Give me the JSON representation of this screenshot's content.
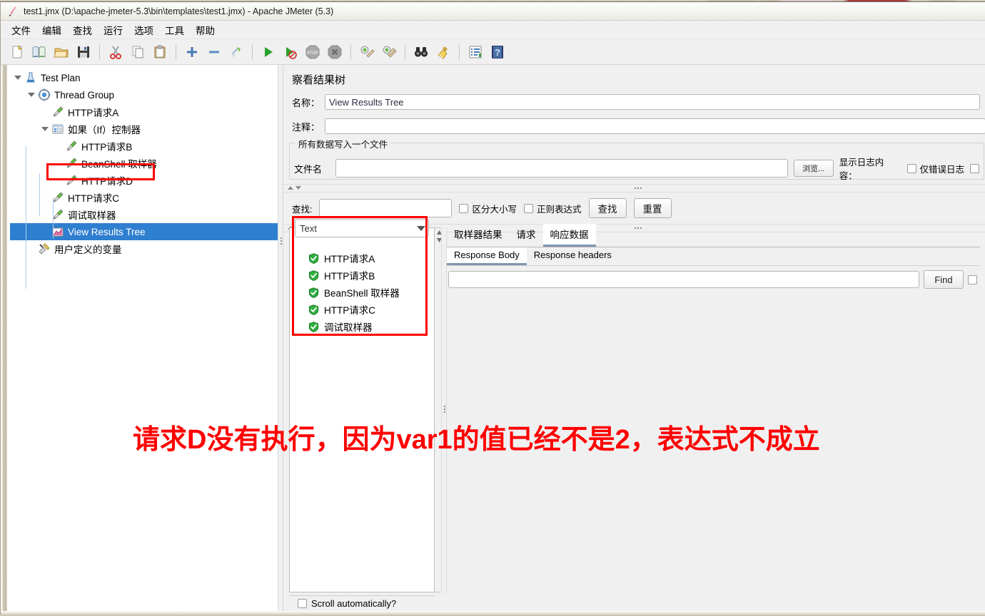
{
  "window": {
    "title": "test1.jmx (D:\\apache-jmeter-5.3\\bin\\templates\\test1.jmx) - Apache JMeter (5.3)",
    "logo_icon": "jmeter-feather-icon"
  },
  "menubar": {
    "items": [
      {
        "label": "文件"
      },
      {
        "label": "编辑"
      },
      {
        "label": "查找"
      },
      {
        "label": "运行"
      },
      {
        "label": "选项"
      },
      {
        "label": "工具"
      },
      {
        "label": "帮助"
      }
    ]
  },
  "toolbar": {
    "buttons": [
      {
        "name": "new-icon",
        "glyph": "new"
      },
      {
        "name": "templates-icon",
        "glyph": "templates"
      },
      {
        "name": "open-icon",
        "glyph": "open"
      },
      {
        "name": "save-icon",
        "glyph": "save"
      },
      {
        "name": "cut-icon",
        "glyph": "cut"
      },
      {
        "name": "copy-icon",
        "glyph": "copy"
      },
      {
        "name": "paste-icon",
        "glyph": "paste"
      },
      {
        "name": "expand-all-icon",
        "glyph": "plus"
      },
      {
        "name": "collapse-all-icon",
        "glyph": "minus"
      },
      {
        "name": "toggle-icon",
        "glyph": "toggle"
      },
      {
        "name": "start-icon",
        "glyph": "play"
      },
      {
        "name": "start-no-pauses-icon",
        "glyph": "play-no"
      },
      {
        "name": "stop-icon",
        "glyph": "stop"
      },
      {
        "name": "shutdown-icon",
        "glyph": "shutdown"
      },
      {
        "name": "clear-icon",
        "glyph": "clear"
      },
      {
        "name": "clear-all-icon",
        "glyph": "clear-all"
      },
      {
        "name": "search-icon",
        "glyph": "binoculars"
      },
      {
        "name": "reset-search-icon",
        "glyph": "broom"
      },
      {
        "name": "function-helper-icon",
        "glyph": "list"
      },
      {
        "name": "help-icon",
        "glyph": "help"
      }
    ]
  },
  "tree": {
    "nodes": [
      {
        "label": "Test Plan",
        "depth": 0,
        "icon": "test-plan-icon",
        "expanded": true,
        "selected": false,
        "highlighted": false
      },
      {
        "label": "Thread Group",
        "depth": 1,
        "icon": "thread-group-icon",
        "expanded": true,
        "selected": false,
        "highlighted": false
      },
      {
        "label": "HTTP请求A",
        "depth": 2,
        "icon": "http-sampler-icon",
        "expanded": null,
        "selected": false,
        "highlighted": false
      },
      {
        "label": "如果（If）控制器",
        "depth": 2,
        "icon": "if-controller-icon",
        "expanded": true,
        "selected": false,
        "highlighted": false
      },
      {
        "label": "HTTP请求B",
        "depth": 3,
        "icon": "http-sampler-icon",
        "expanded": null,
        "selected": false,
        "highlighted": false
      },
      {
        "label": "BeanShell 取样器",
        "depth": 3,
        "icon": "http-sampler-icon",
        "expanded": null,
        "selected": false,
        "highlighted": false
      },
      {
        "label": "HTTP请求D",
        "depth": 3,
        "icon": "http-sampler-icon",
        "expanded": null,
        "selected": false,
        "highlighted": true
      },
      {
        "label": "HTTP请求C",
        "depth": 2,
        "icon": "http-sampler-icon",
        "expanded": null,
        "selected": false,
        "highlighted": false
      },
      {
        "label": "调试取样器",
        "depth": 2,
        "icon": "http-sampler-icon",
        "expanded": null,
        "selected": false,
        "highlighted": false
      },
      {
        "label": "View Results Tree",
        "depth": 2,
        "icon": "view-results-tree-icon",
        "expanded": null,
        "selected": true,
        "highlighted": false
      },
      {
        "label": "用户定义的变量",
        "depth": 1,
        "icon": "user-vars-icon",
        "expanded": null,
        "selected": false,
        "highlighted": false
      }
    ]
  },
  "panel": {
    "title": "察看结果树",
    "name_label": "名称：",
    "name_value": "View Results Tree",
    "comment_label": "注释：",
    "comment_value": "",
    "file_group_title": "所有数据写入一个文件",
    "filename_label": "文件名",
    "filename_value": "",
    "browse_button": "浏览...",
    "log_display_label": "显示日志内容：",
    "errors_only_label": "仅错误日志",
    "errors_only_checked": false,
    "successes_only_checked": false,
    "search_label": "查找:",
    "search_value": "",
    "case_sensitive_label": "区分大小写",
    "case_sensitive_checked": false,
    "regex_label": "正则表达式",
    "regex_checked": false,
    "find_button": "查找",
    "reset_button": "重置",
    "renderer_selected": "Text",
    "scroll_auto_label": "Scroll automatically?",
    "scroll_auto_checked": false
  },
  "results": {
    "items": [
      {
        "label": "HTTP请求A",
        "status": "success-shield-icon"
      },
      {
        "label": "HTTP请求B",
        "status": "success-shield-icon"
      },
      {
        "label": "BeanShell 取样器",
        "status": "success-shield-icon"
      },
      {
        "label": "HTTP请求C",
        "status": "success-shield-icon"
      },
      {
        "label": "调试取样器",
        "status": "success-shield-icon"
      }
    ]
  },
  "detail": {
    "tabs": [
      {
        "label": "取样器结果",
        "active": false
      },
      {
        "label": "请求",
        "active": false
      },
      {
        "label": "响应数据",
        "active": true
      }
    ],
    "subtabs": [
      {
        "label": "Response Body",
        "active": true
      },
      {
        "label": "Response headers",
        "active": false
      }
    ],
    "find_value": "",
    "find_button": "Find",
    "case_checkbox_checked": false,
    "body_text": ""
  },
  "annotation": {
    "text": "请求D没有执行，因为var1的值已经不是2，表达式不成立",
    "color": "#ff0000"
  },
  "colors": {
    "selection_blue": "#2f7fd0",
    "highlight_red": "#ff0000",
    "panel_bg": "#f0f0f0",
    "tree_bg": "#ffffff",
    "tab_underline": "#8095b0"
  }
}
